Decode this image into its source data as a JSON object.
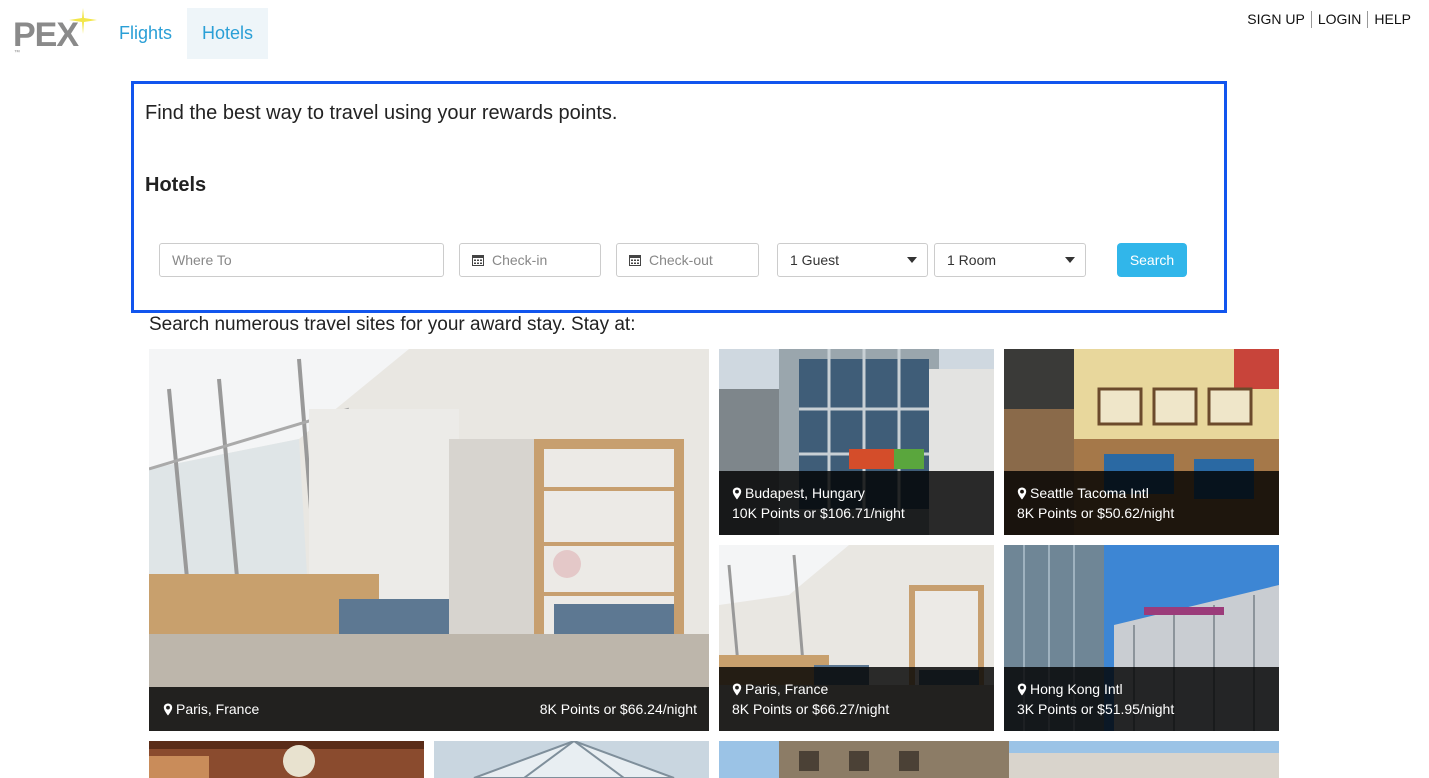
{
  "header": {
    "logo_text": "PEX",
    "logo_tm": "™",
    "nav": [
      {
        "label": "Flights"
      },
      {
        "label": "Hotels"
      }
    ],
    "account": {
      "sign_up": "SIGN UP",
      "login": "LOGIN",
      "help": "HELP"
    }
  },
  "search": {
    "tagline": "Find the best way to travel using your rewards points.",
    "section_title": "Hotels",
    "where_placeholder": "Where To",
    "checkin_placeholder": "Check-in",
    "checkout_placeholder": "Check-out",
    "guests_value": "1 Guest",
    "rooms_value": "1 Room",
    "button_label": "Search"
  },
  "results": {
    "heading": "Search numerous travel sites for your award stay. Stay at:",
    "cards": [
      {
        "location": "Paris, France",
        "price": "8K Points or $66.24/night"
      },
      {
        "location": "Budapest, Hungary",
        "price": "10K Points or $106.71/night"
      },
      {
        "location": "Seattle Tacoma Intl",
        "price": "8K Points or $50.62/night"
      },
      {
        "location": "Paris, France",
        "price": "8K Points or $66.27/night"
      },
      {
        "location": "Hong Kong Intl",
        "price": "3K Points or $51.95/night"
      }
    ]
  },
  "colors": {
    "accent": "#2a9fd6",
    "panel_border": "#1155ee",
    "button": "#31b6ea"
  }
}
